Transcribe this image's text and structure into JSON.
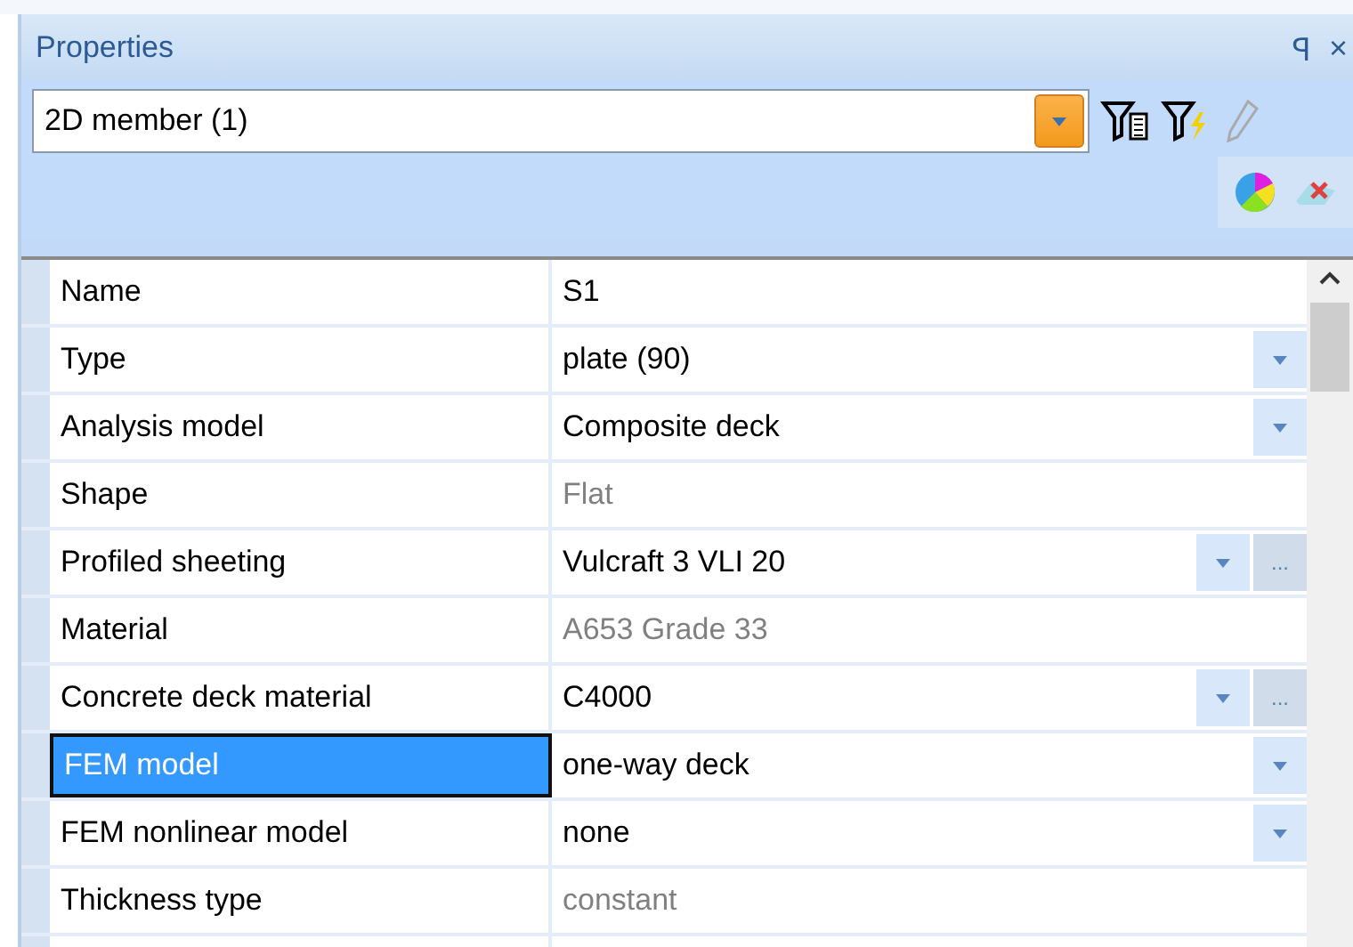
{
  "panel": {
    "title": "Properties",
    "pin_glyph": "ꟼ",
    "close_glyph": "×"
  },
  "selector": {
    "value": "2D member (1)"
  },
  "properties": [
    {
      "name": "Name",
      "value": "S1",
      "kind": "text",
      "readonly": false,
      "selected": false
    },
    {
      "name": "Type",
      "value": "plate (90)",
      "kind": "dropdown",
      "readonly": false,
      "selected": false
    },
    {
      "name": "Analysis model",
      "value": "Composite deck",
      "kind": "dropdown",
      "readonly": false,
      "selected": false
    },
    {
      "name": "Shape",
      "value": "Flat",
      "kind": "text",
      "readonly": true,
      "selected": false
    },
    {
      "name": "Profiled sheeting",
      "value": "Vulcraft 3 VLI 20",
      "kind": "dropdown_browse",
      "readonly": false,
      "selected": false
    },
    {
      "name": "Material",
      "value": "A653 Grade 33",
      "kind": "text",
      "readonly": true,
      "selected": false
    },
    {
      "name": "Concrete deck material",
      "value": "C4000",
      "kind": "dropdown_browse",
      "readonly": false,
      "selected": false
    },
    {
      "name": "FEM model",
      "value": "one-way deck",
      "kind": "dropdown",
      "readonly": false,
      "selected": true
    },
    {
      "name": "FEM nonlinear model",
      "value": "none",
      "kind": "dropdown",
      "readonly": false,
      "selected": false
    },
    {
      "name": "Thickness type",
      "value": "constant",
      "kind": "text",
      "readonly": true,
      "selected": false
    }
  ],
  "browse_label": "..."
}
